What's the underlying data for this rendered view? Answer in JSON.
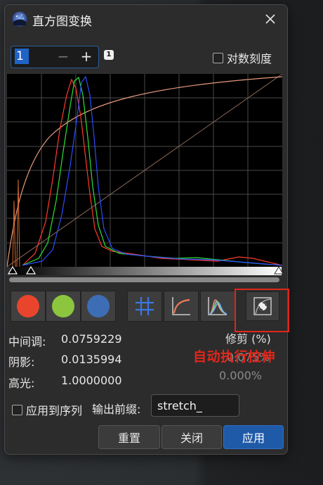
{
  "window": {
    "title": "直方图变换",
    "close_icon": "close-icon",
    "app_icon": "starfield-icon"
  },
  "channel_spin": {
    "value": "1",
    "minus": "−",
    "plus": "+",
    "badge": "1"
  },
  "log_scale": {
    "label": "对数刻度",
    "checked": false
  },
  "channel_buttons": [
    {
      "name": "red",
      "color": "#e8452c"
    },
    {
      "name": "green",
      "color": "#8cc63f"
    },
    {
      "name": "blue",
      "color": "#3d6db5"
    }
  ],
  "tools": {
    "grid_icon": "grid-icon",
    "curve_icon": "curve-icon",
    "histogram_icon": "histogram-icon",
    "auto_stretch_icon": "auto-stretch-icon"
  },
  "stats": [
    {
      "label": "中间调:",
      "value": "0.0759229"
    },
    {
      "label": "阴影:",
      "value": "0.0135994"
    },
    {
      "label": "高光:",
      "value": "1.0000000"
    }
  ],
  "trim": {
    "label": "修剪 (%)",
    "value_a": "0.075%",
    "value_b": "0.000%"
  },
  "annotation": "自动执行拉伸",
  "apply_to_sequence": {
    "label": "应用到序列",
    "checked": false
  },
  "output_prefix": {
    "label": "输出前缀:",
    "value": "stretch_"
  },
  "buttons": {
    "reset": "重置",
    "close": "关闭",
    "apply": "应用"
  },
  "colors": {
    "accent": "#1f5aa8",
    "highlight_box": "#e0261b"
  }
}
